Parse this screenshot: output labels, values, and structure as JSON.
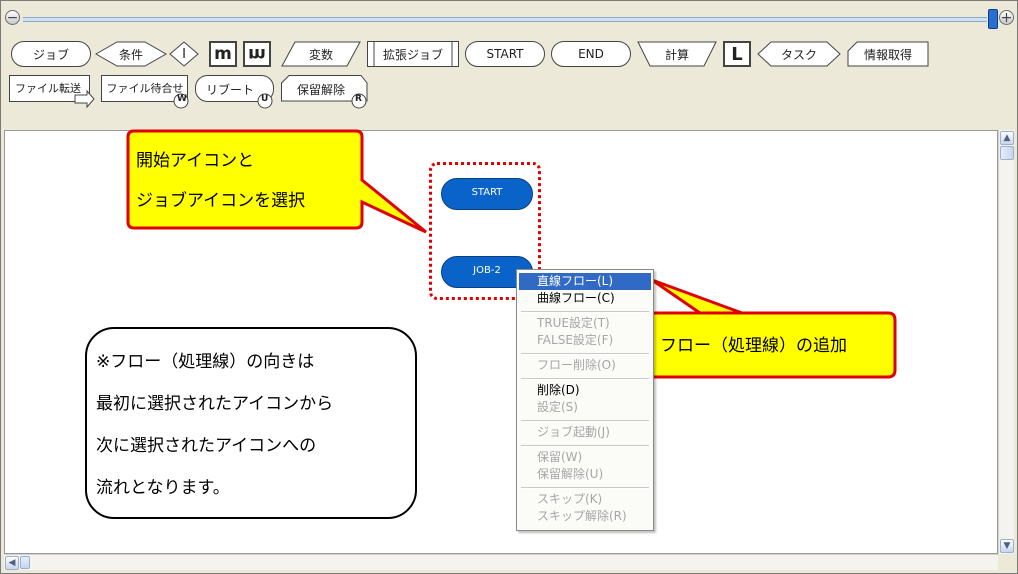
{
  "zoom": {
    "minus_glyph": "−",
    "plus_glyph": "+"
  },
  "palette": {
    "job": "ジョブ",
    "condition": "条件",
    "branch_symbol": "I",
    "parallel_start_symbol": "m",
    "parallel_end_symbol": "m",
    "variable": "変数",
    "extended_job": "拡張ジョブ",
    "start": "START",
    "end": "END",
    "calc": "計算",
    "loop_symbol": "L",
    "task": "タスク",
    "info_get": "情報取得",
    "file_transfer": "ファイル転送",
    "file_wait": "ファイル待合せ",
    "reboot": "リブート",
    "hold_release": "保留解除",
    "wait_badge": "W",
    "reboot_badge": "U",
    "release_badge": "R"
  },
  "flow": {
    "start_node": "START",
    "job_node": "JOB-2"
  },
  "context_menu": {
    "items": [
      "直線フロー(L)",
      "曲線フロー(C)",
      "TRUE設定(T)",
      "FALSE設定(F)",
      "フロー削除(O)",
      "削除(D)",
      "設定(S)",
      "ジョブ起動(J)",
      "保留(W)",
      "保留解除(U)",
      "スキップ(K)",
      "スキップ解除(R)"
    ]
  },
  "callouts": {
    "select_line1": "開始アイコンと",
    "select_line2": "ジョブアイコンを選択",
    "add_flow": "フロー（処理線）の追加",
    "note_line1": "※フロー（処理線）の向きは",
    "note_line2": "最初に選択されたアイコンから",
    "note_line3": "次に選択されたアイコンへの",
    "note_line4": "流れとなります。"
  },
  "colors": {
    "node_fill": "#0a63c9",
    "callout_fill": "#ffff00",
    "callout_border": "#e00000",
    "selection_border": "#e00000",
    "menu_highlight": "#316ac5"
  }
}
